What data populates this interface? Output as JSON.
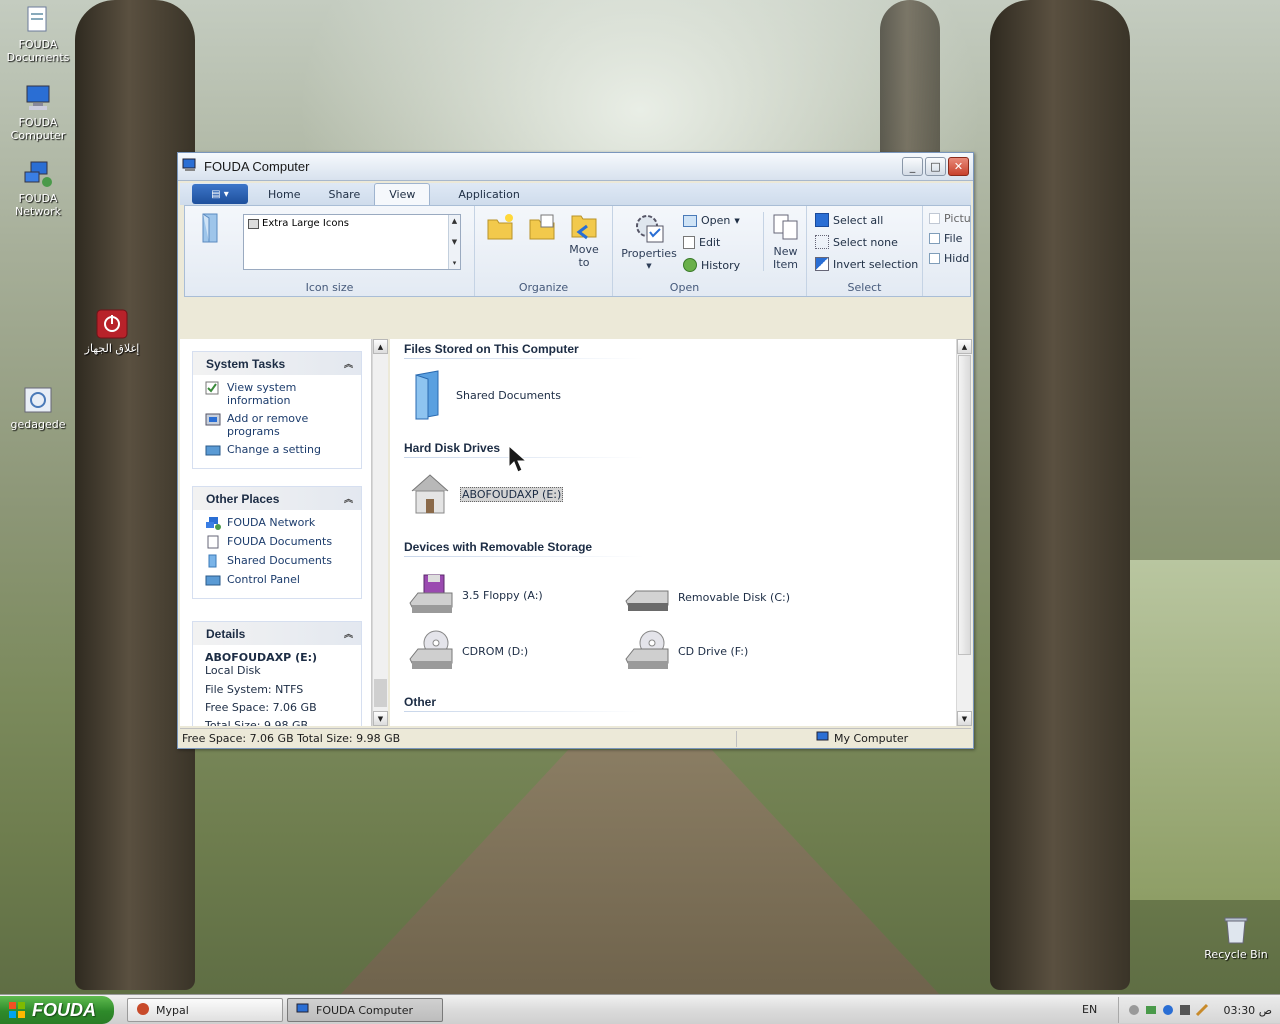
{
  "desktop": {
    "icons": [
      {
        "label": "FOUDA Documents"
      },
      {
        "label": "FOUDA Computer"
      },
      {
        "label": "FOUDA Network"
      },
      {
        "label": "إغلاق الجهاز"
      },
      {
        "label": "gedagede"
      },
      {
        "label": "Recycle Bin"
      }
    ]
  },
  "window": {
    "title": "FOUDA Computer",
    "buttons": {
      "minimize": "_",
      "maximize": "□",
      "close": "✕"
    }
  },
  "ribbon": {
    "tabs": [
      "Home",
      "Share",
      "View",
      "Application"
    ],
    "active_tab": "View",
    "layout": {
      "icon_size_value": "Extra Large Icons",
      "group_label": "Icon size"
    },
    "organize": {
      "move_to": "Move to",
      "group_label": "Organize"
    },
    "open": {
      "properties": "Properties",
      "open": "Open",
      "edit": "Edit",
      "history": "History",
      "new_item": "New Item",
      "group_label": "Open"
    },
    "select": {
      "select_all": "Select all",
      "select_none": "Select none",
      "invert_selection": "Invert selection",
      "group_label": "Select"
    },
    "show_hide": [
      "Pictu",
      "File",
      "Hidd"
    ]
  },
  "taskpane": {
    "system_tasks": {
      "title": "System Tasks",
      "items": [
        "View system information",
        "Add or remove programs",
        "Change a setting"
      ]
    },
    "other_places": {
      "title": "Other Places",
      "items": [
        "FOUDA Network",
        "FOUDA Documents",
        "Shared Documents",
        "Control Panel"
      ]
    },
    "details": {
      "title": "Details",
      "name": "ABOFOUDAXP (E:)",
      "type": "Local Disk",
      "file_system": "File System: NTFS",
      "free_space": "Free Space: 7.06 GB",
      "total_size": "Total Size: 9.98 GB"
    }
  },
  "main": {
    "sections": {
      "files": "Files Stored on This Computer",
      "hdd": "Hard Disk Drives",
      "removable": "Devices with Removable Storage",
      "other": "Other"
    },
    "items": {
      "shared_docs": "Shared Documents",
      "hdd_e": "ABOFOUDAXP (E:)",
      "floppy": "3.5 Floppy (A:)",
      "removable_c": "Removable Disk (C:)",
      "cdrom_d": "CDROM (D:)",
      "cd_f": "CD Drive (F:)"
    }
  },
  "statusbar": {
    "left": "Free Space: 7.06 GB Total Size: 9.98 GB",
    "right": "My Computer"
  },
  "taskbar": {
    "start": "FOUDA",
    "buttons": [
      "Mypal",
      "FOUDA Computer"
    ],
    "language": "EN",
    "clock": "03:30 ص"
  },
  "colors": {
    "accent": "#1e4f9c",
    "start_green": "#2e8a2a",
    "title_text": "#1a1a1a",
    "link": "#1c3c6c"
  }
}
